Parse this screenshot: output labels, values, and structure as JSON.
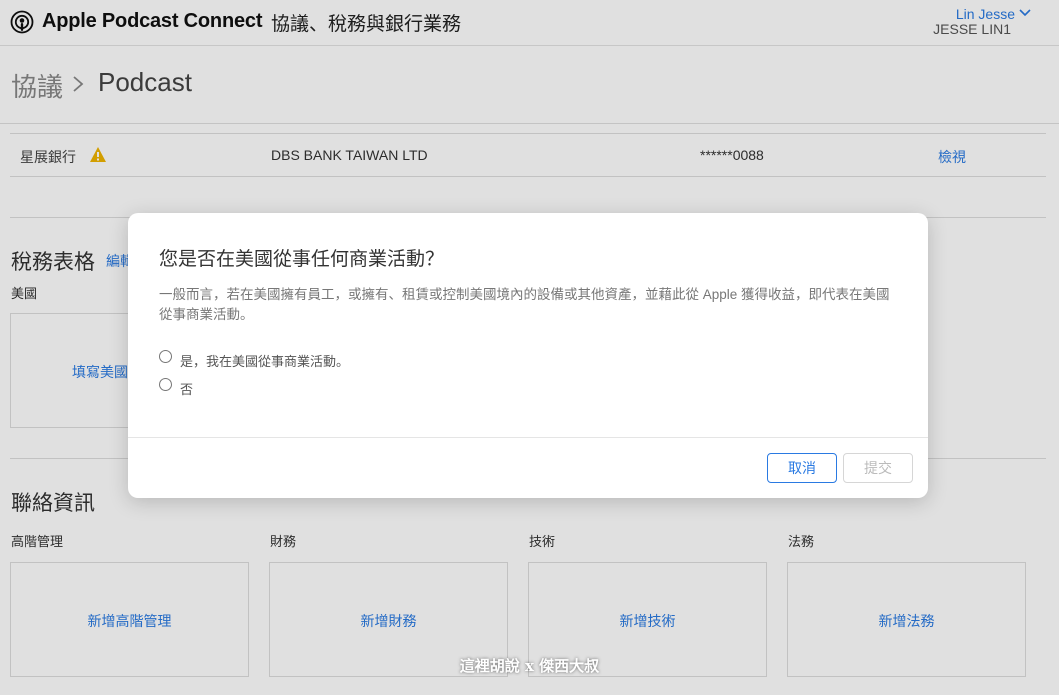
{
  "header": {
    "brand": "Apple Podcast Connect",
    "section": "協議、稅務與銀行業務",
    "user_name": "Lin Jesse",
    "user_id": "JESSE LIN1",
    "logo_icon": "podcast-icon"
  },
  "breadcrumb": {
    "parent": "協議",
    "current": "Podcast"
  },
  "bank": {
    "name": "星展銀行",
    "legal_name": "DBS BANK TAIWAN LTD",
    "account": "******0088",
    "view_label": "檢視",
    "warning_color": "#f0b400"
  },
  "tax": {
    "title": "稅務表格",
    "edit_label": "編輯",
    "country": "美國",
    "card_link": "填寫美國稅務表格"
  },
  "contacts": {
    "title": "聯絡資訊",
    "items": [
      {
        "label": "高階管理",
        "action": "新增高階管理"
      },
      {
        "label": "財務",
        "action": "新增財務"
      },
      {
        "label": "技術",
        "action": "新增技術"
      },
      {
        "label": "法務",
        "action": "新增法務"
      }
    ]
  },
  "modal": {
    "title": "您是否在美國從事任何商業活動？",
    "description": "一般而言，若在美國擁有員工，或擁有、租賃或控制美國境內的設備或其他資產，並藉此從 Apple 獲得收益，即代表在美國從事商業活動。",
    "options": [
      {
        "label": "是，我在美國從事商業活動。",
        "selected": false
      },
      {
        "label": "否",
        "selected": false
      }
    ],
    "cancel_label": "取消",
    "submit_label": "提交"
  },
  "watermark": "這裡胡說 x 傑西大叔",
  "colors": {
    "accent": "#2a7ae2"
  }
}
